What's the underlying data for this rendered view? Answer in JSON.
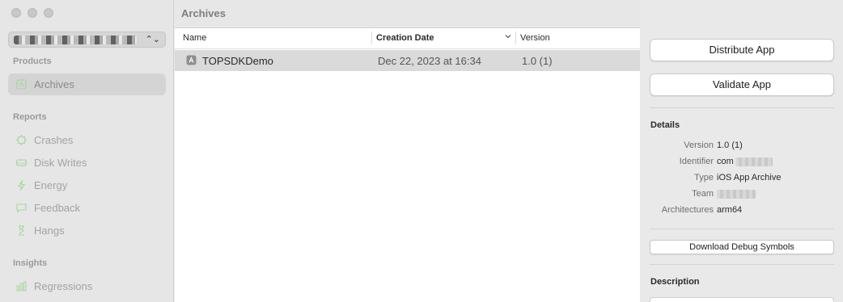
{
  "sidebar": {
    "sections": {
      "products": "Products",
      "reports": "Reports",
      "insights": "Insights"
    },
    "items": {
      "archives": "Archives",
      "crashes": "Crashes",
      "disk_writes": "Disk Writes",
      "energy": "Energy",
      "feedback": "Feedback",
      "hangs": "Hangs",
      "regressions": "Regressions"
    }
  },
  "main": {
    "title": "Archives",
    "columns": {
      "name": "Name",
      "creation_date": "Creation Date",
      "version": "Version"
    },
    "rows": [
      {
        "name": "TOPSDKDemo",
        "date": "Dec 22, 2023 at 16:34",
        "version": "1.0 (1)"
      }
    ]
  },
  "inspector": {
    "distribute": "Distribute App",
    "validate": "Validate App",
    "details_title": "Details",
    "details": {
      "version_label": "Version",
      "version_value": "1.0 (1)",
      "identifier_label": "Identifier",
      "identifier_value": "com",
      "type_label": "Type",
      "type_value": "iOS App Archive",
      "team_label": "Team",
      "arch_label": "Architectures",
      "arch_value": "arm64"
    },
    "download_symbols": "Download Debug Symbols",
    "description_title": "Description"
  },
  "colors": {
    "selected_row": "#dadada",
    "sidebar_bg": "#e6e6e6",
    "icon_tint": "#a8d5a0"
  }
}
